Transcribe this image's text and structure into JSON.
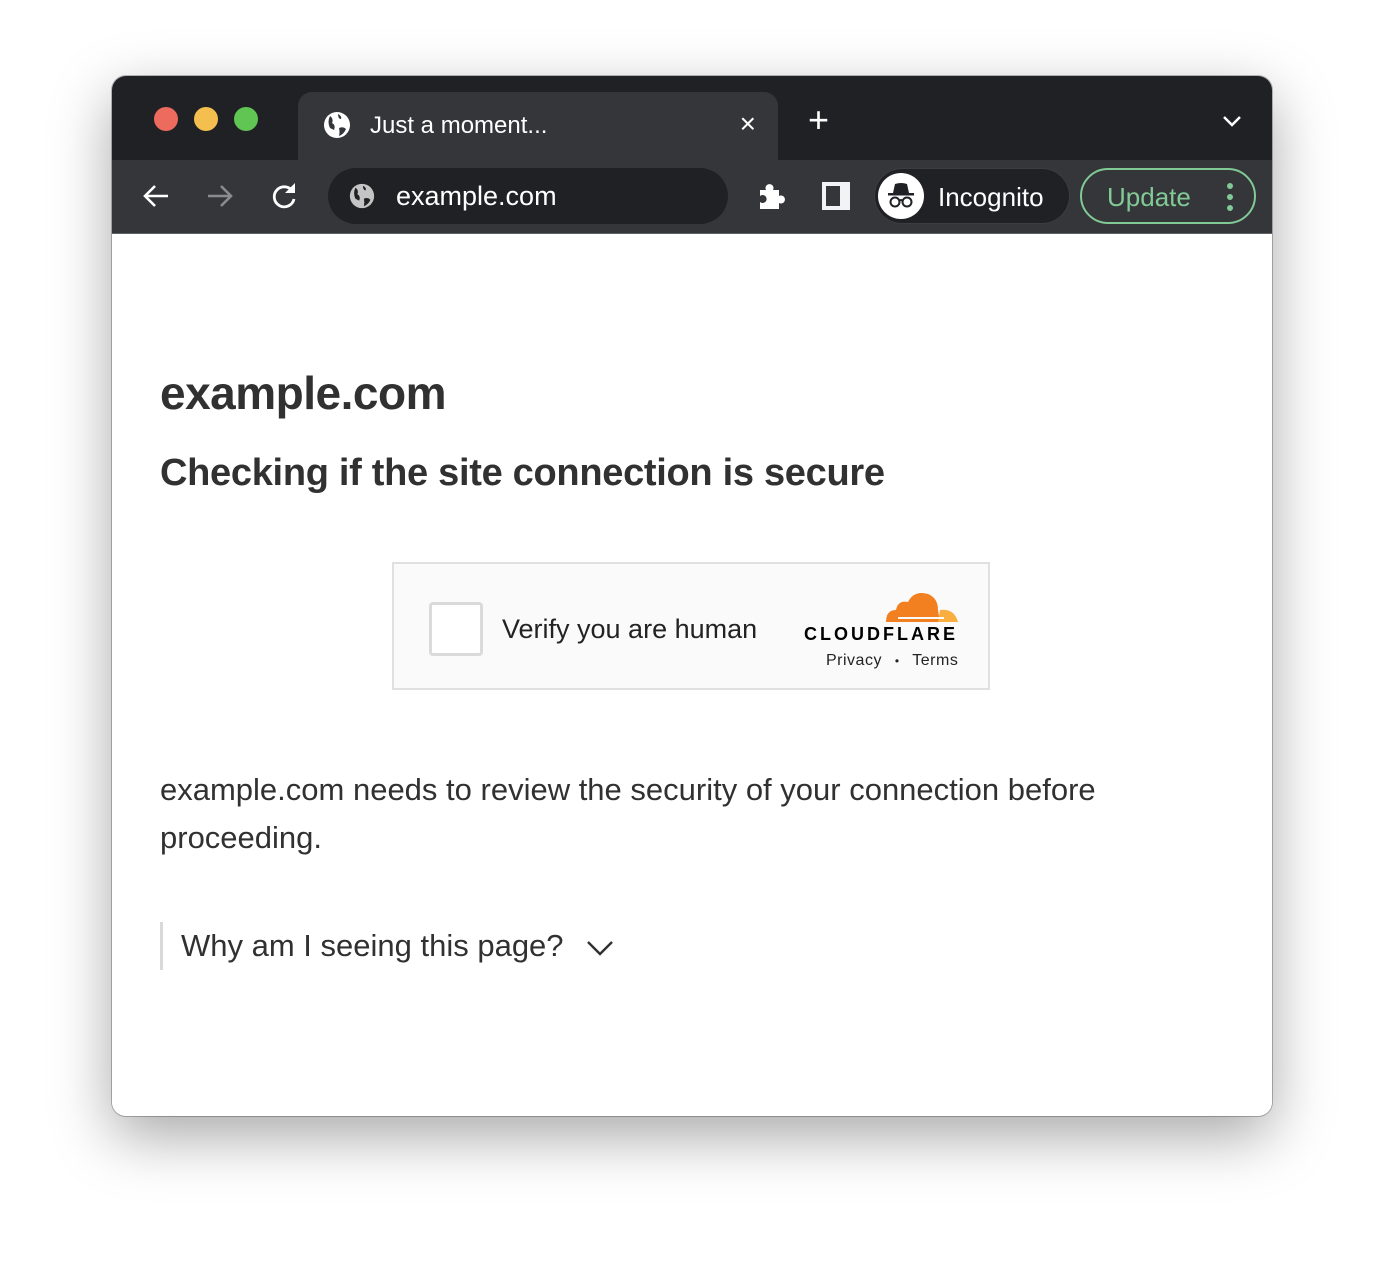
{
  "window": {
    "traffic_lights": {
      "close": "#ed6a5e",
      "minimize": "#f5bf4f",
      "zoom": "#61c554"
    }
  },
  "tab": {
    "title": "Just a moment...",
    "icon": "globe-icon",
    "close": "×"
  },
  "tabstrip": {
    "new_tab": "+"
  },
  "toolbar": {
    "address": "example.com",
    "profile_label": "Incognito",
    "update_label": "Update",
    "accent": "#81c995"
  },
  "page": {
    "site": "example.com",
    "heading": "Checking if the site connection is secure",
    "challenge": {
      "label": "Verify you are human",
      "brand": "CLOUDFLARE",
      "privacy": "Privacy",
      "separator": "•",
      "terms": "Terms",
      "brand_colors": [
        "#f38020",
        "#faae40"
      ]
    },
    "description": "example.com needs to review the security of your connection before proceeding.",
    "why": "Why am I seeing this page?"
  }
}
